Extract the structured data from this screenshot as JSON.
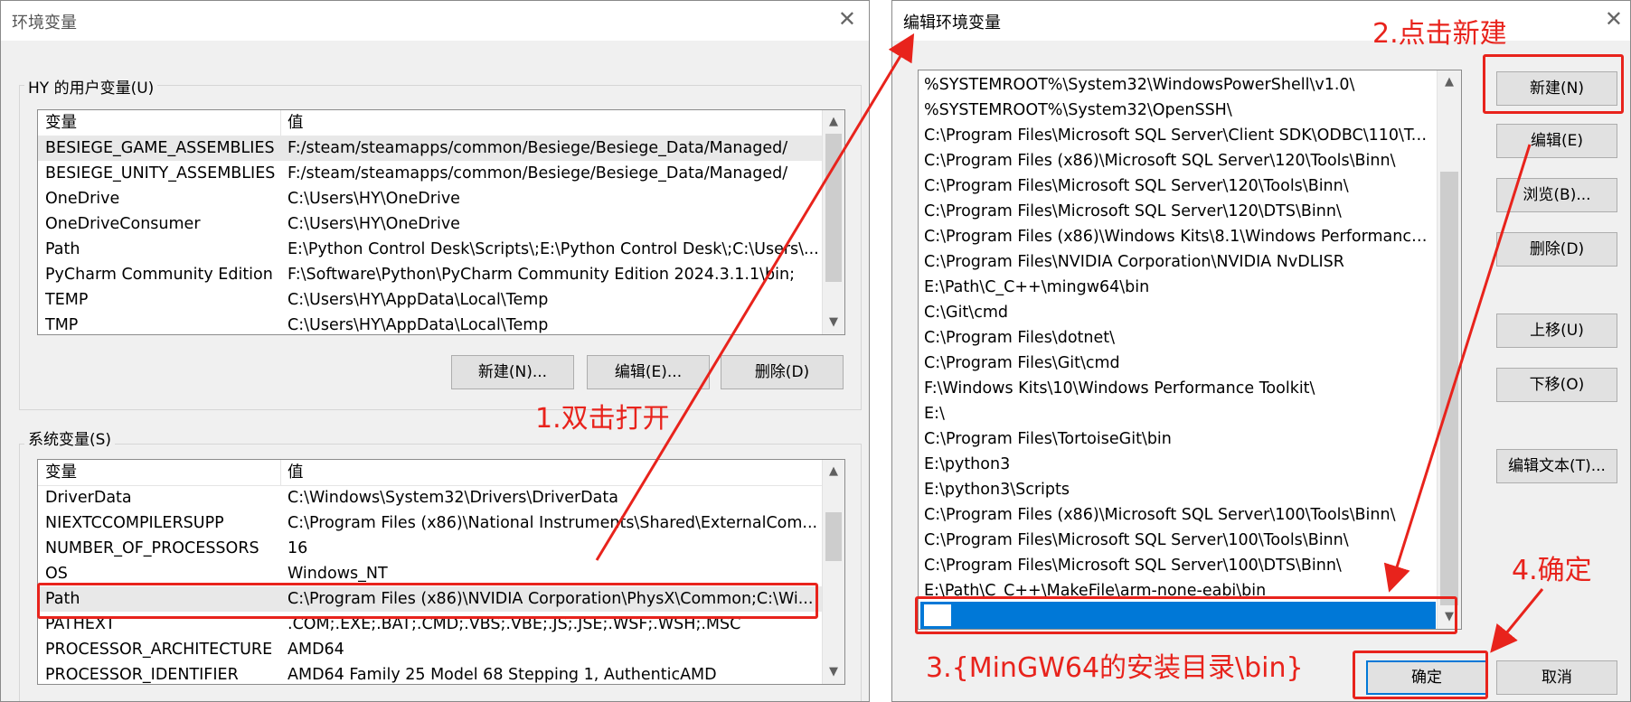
{
  "left_window": {
    "title": "环境变量",
    "user_group_label": "HY 的用户变量(U)",
    "columns": [
      "变量",
      "值"
    ],
    "user_vars": [
      {
        "name": "BESIEGE_GAME_ASSEMBLIES",
        "value": "F:/steam/steamapps/common/Besiege/Besiege_Data/Managed/"
      },
      {
        "name": "BESIEGE_UNITY_ASSEMBLIES",
        "value": "F:/steam/steamapps/common/Besiege/Besiege_Data/Managed/"
      },
      {
        "name": "OneDrive",
        "value": "C:\\Users\\HY\\OneDrive"
      },
      {
        "name": "OneDriveConsumer",
        "value": "C:\\Users\\HY\\OneDrive"
      },
      {
        "name": "Path",
        "value": "E:\\Python Control Desk\\Scripts\\;E:\\Python Control Desk\\;C:\\Users\\..."
      },
      {
        "name": "PyCharm Community Edition",
        "value": "F:\\Software\\Python\\PyCharm Community Edition 2024.3.1.1\\bin;"
      },
      {
        "name": "TEMP",
        "value": "C:\\Users\\HY\\AppData\\Local\\Temp"
      },
      {
        "name": "TMP",
        "value": "C:\\Users\\HY\\AppData\\Local\\Temp"
      }
    ],
    "user_buttons": {
      "new": "新建(N)...",
      "edit": "编辑(E)...",
      "delete": "删除(D)"
    },
    "system_group_label": "系统变量(S)",
    "system_vars": [
      {
        "name": "DriverData",
        "value": "C:\\Windows\\System32\\Drivers\\DriverData"
      },
      {
        "name": "NIEXTCCOMPILERSUPP",
        "value": "C:\\Program Files (x86)\\National Instruments\\Shared\\ExternalCom..."
      },
      {
        "name": "NUMBER_OF_PROCESSORS",
        "value": "16"
      },
      {
        "name": "OS",
        "value": "Windows_NT"
      },
      {
        "name": "Path",
        "value": "C:\\Program Files (x86)\\NVIDIA Corporation\\PhysX\\Common;C:\\Wi..."
      },
      {
        "name": "PATHEXT",
        "value": ".COM;.EXE;.BAT;.CMD;.VBS;.VBE;.JS;.JSE;.WSF;.WSH;.MSC"
      },
      {
        "name": "PROCESSOR_ARCHITECTURE",
        "value": "AMD64"
      },
      {
        "name": "PROCESSOR_IDENTIFIER",
        "value": "AMD64 Family 25 Model 68 Stepping 1, AuthenticAMD"
      }
    ]
  },
  "right_window": {
    "title": "编辑环境变量",
    "paths": [
      "%SYSTEMROOT%\\System32\\WindowsPowerShell\\v1.0\\",
      "%SYSTEMROOT%\\System32\\OpenSSH\\",
      "C:\\Program Files\\Microsoft SQL Server\\Client SDK\\ODBC\\110\\Too...",
      "C:\\Program Files (x86)\\Microsoft SQL Server\\120\\Tools\\Binn\\",
      "C:\\Program Files\\Microsoft SQL Server\\120\\Tools\\Binn\\",
      "C:\\Program Files\\Microsoft SQL Server\\120\\DTS\\Binn\\",
      "C:\\Program Files (x86)\\Windows Kits\\8.1\\Windows Performance T...",
      "C:\\Program Files\\NVIDIA Corporation\\NVIDIA NvDLISR",
      "E:\\Path\\C_C++\\mingw64\\bin",
      "C:\\Git\\cmd",
      "C:\\Program Files\\dotnet\\",
      "C:\\Program Files\\Git\\cmd",
      "F:\\Windows Kits\\10\\Windows Performance Toolkit\\",
      "E:\\",
      "C:\\Program Files\\TortoiseGit\\bin",
      "E:\\python3",
      "E:\\python3\\Scripts",
      "C:\\Program Files (x86)\\Microsoft SQL Server\\100\\Tools\\Binn\\",
      "C:\\Program Files\\Microsoft SQL Server\\100\\Tools\\Binn\\",
      "C:\\Program Files\\Microsoft SQL Server\\100\\DTS\\Binn\\",
      "E:\\Path\\C_C++\\MakeFile\\arm-none-eabi\\bin"
    ],
    "buttons": {
      "new": "新建(N)",
      "edit": "编辑(E)",
      "browse": "浏览(B)...",
      "delete": "删除(D)",
      "move_up": "上移(U)",
      "move_down": "下移(O)",
      "edit_text": "编辑文本(T)...",
      "ok": "确定",
      "cancel": "取消"
    }
  },
  "annotations": {
    "step1": "1.双击打开",
    "step2": "2.点击新建",
    "step3": "3.{MinGW64的安装目录\\bin}",
    "step4": "4.确定"
  },
  "colors": {
    "annotation_red": "#e8231c",
    "selection_blue": "#0078d7"
  }
}
